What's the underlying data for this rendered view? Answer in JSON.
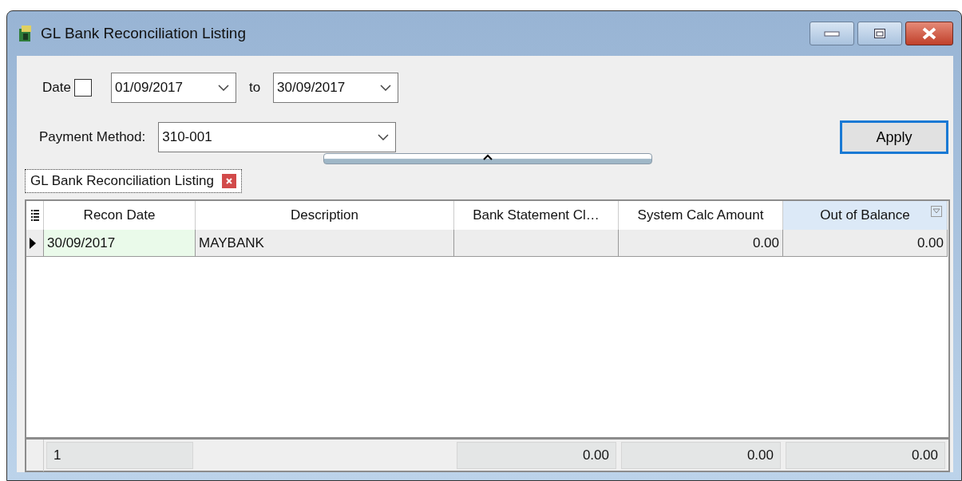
{
  "window": {
    "title": "GL Bank Reconciliation Listing"
  },
  "filters": {
    "date_label": "Date",
    "date_checked": false,
    "from": "01/09/2017",
    "to_label": "to",
    "to": "30/09/2017",
    "payment_label": "Payment Method:",
    "payment_value": "310-001"
  },
  "apply_button": {
    "label": "Apply",
    "focused": true
  },
  "tabs": [
    {
      "label": "GL Bank Reconciliation Listing",
      "selected": true
    }
  ],
  "grid": {
    "columns": [
      {
        "label": "Recon Date",
        "highlighted": false
      },
      {
        "label": "Description",
        "highlighted": false
      },
      {
        "label": "Bank Statement Cl…",
        "highlighted": false
      },
      {
        "label": "System Calc Amount",
        "highlighted": false
      },
      {
        "label": "Out of Balance",
        "highlighted": true
      }
    ],
    "rows": [
      {
        "selected": true,
        "cells": [
          "30/09/2017",
          "MAYBANK"
        ],
        "amounts": [
          "0.00",
          "0.00"
        ]
      }
    ],
    "footer": {
      "count": "1",
      "totals": [
        "0.00",
        "0.00",
        "0.00"
      ]
    }
  }
}
